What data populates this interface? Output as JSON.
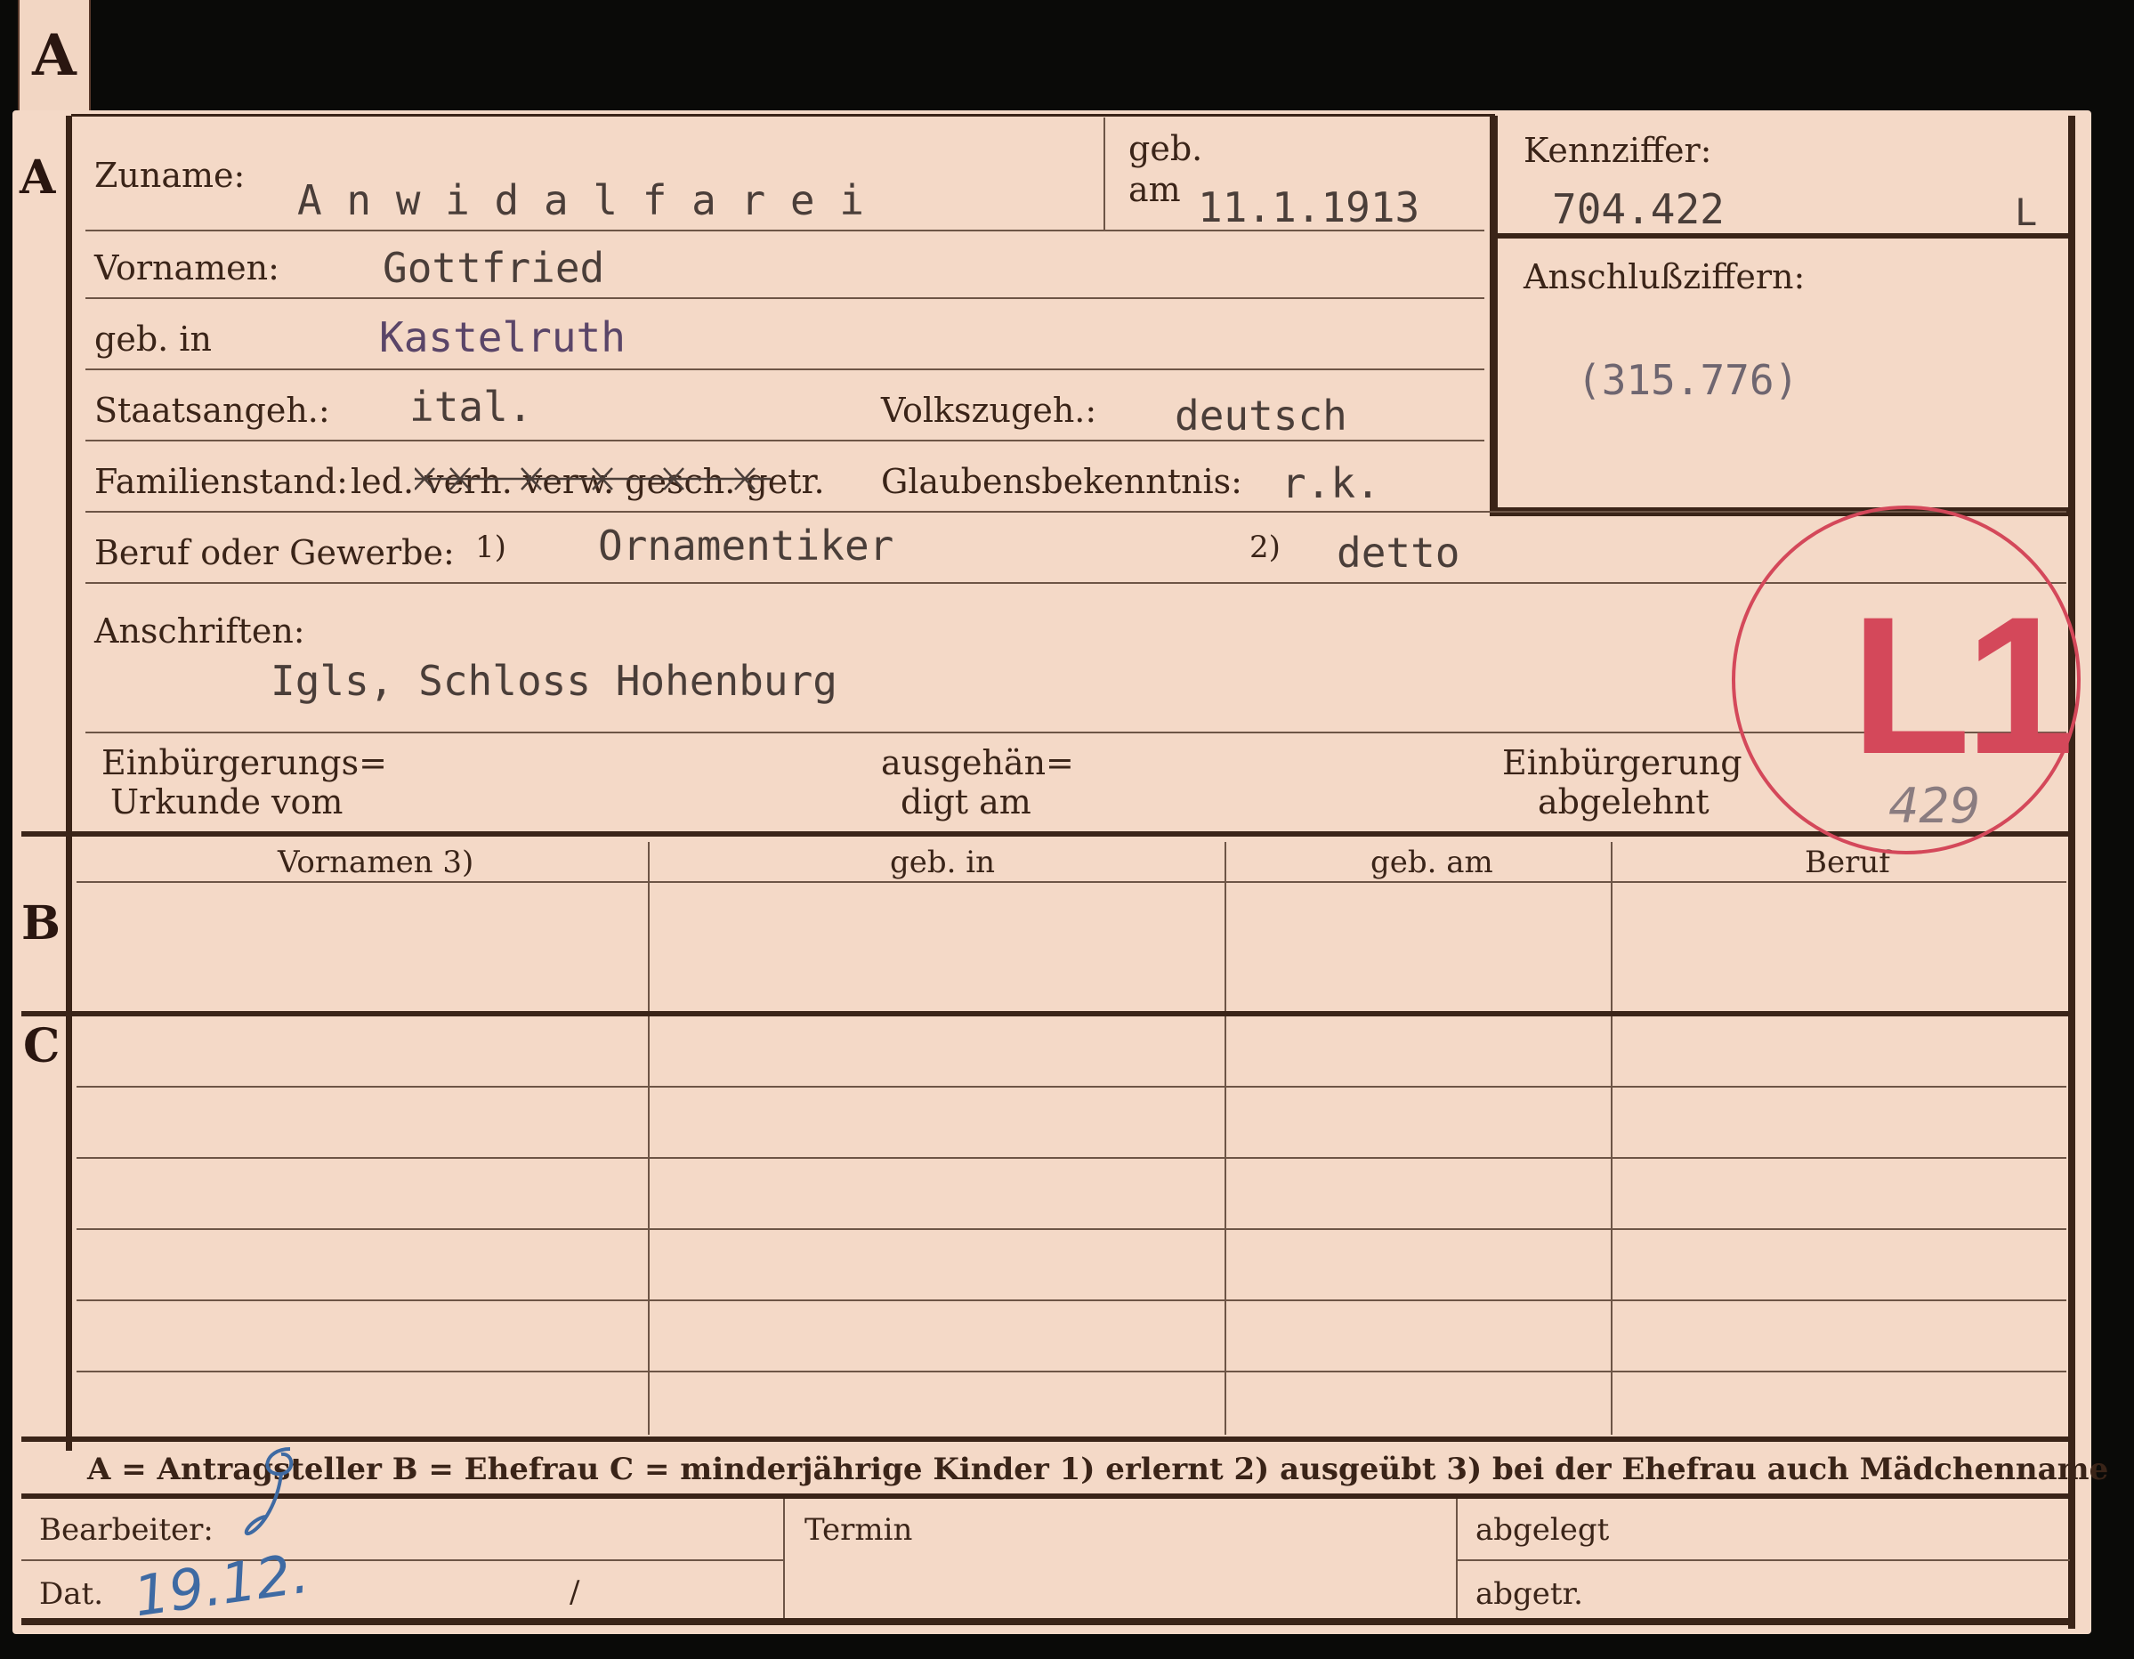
{
  "tab": {
    "letter": "A"
  },
  "sections": {
    "a": "A",
    "b": "B",
    "c": "C"
  },
  "fields": {
    "zuname": {
      "label": "Zuname:",
      "value": "A n w i d a l f a r e i"
    },
    "geb_am": {
      "label_1": "geb.",
      "label_2": "am",
      "value": "11.1.1913"
    },
    "kennziffer": {
      "label": "Kennziffer:",
      "value": "704.422",
      "suffix": "L"
    },
    "anschlussziffern": {
      "label": "Anschlußziffern:",
      "value": "(315.776)"
    },
    "vornamen": {
      "label": "Vornamen:",
      "value": "Gottfried"
    },
    "geb_in": {
      "label": "geb. in",
      "value": "Kastelruth"
    },
    "staatsangeh": {
      "label": "Staatsangeh.:",
      "value": "ital."
    },
    "volkszugeh": {
      "label": "Volkszugeh.:",
      "value": "deutsch"
    },
    "familienstand": {
      "label": "Familienstand:",
      "options": "led. verh. verw. gesch. getr."
    },
    "glaubensbekenntnis": {
      "label": "Glaubensbekenntnis:",
      "value": "r.k."
    },
    "beruf": {
      "label": "Beruf oder Gewerbe:",
      "marker_1": "1)",
      "value_1": "Ornamentiker",
      "marker_2": "2)",
      "value_2": "detto"
    },
    "anschriften": {
      "label": "Anschriften:",
      "value": "Igls, Schloss Hohenburg"
    },
    "einbuergerungsurkunde": {
      "line1": "Einbürgerungs=",
      "line2": "Urkunde vom"
    },
    "ausgehaendigt": {
      "line1": "ausgehän=",
      "line2": "digt am"
    },
    "einbuergerung_abgelehnt": {
      "line1": "Einbürgerung",
      "line2": "abgelehnt"
    }
  },
  "stamp": {
    "text": "L1",
    "pencil_note": "429"
  },
  "table": {
    "headers": [
      "Vornamen 3)",
      "geb. in",
      "geb. am",
      "Beruf"
    ]
  },
  "legend": "A = Antragsteller   B = Ehefrau   C = minderjährige Kinder   1) erlernt   2) ausgeübt   3) bei der Ehefrau auch Mädchenname",
  "footer": {
    "bearbeiter": "Bearbeiter:",
    "dat": "Dat.",
    "dat_value": "19.12.",
    "termin": "Termin",
    "abgelegt": "abgelegt",
    "abgetr": "abgetr."
  }
}
